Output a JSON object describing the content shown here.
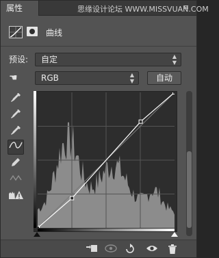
{
  "titlebar": {
    "tab_label": "属性",
    "close_glyph": "✕",
    "menu_glyph": "≡",
    "watermark": "思缘设计论坛 WWW.MISSVUAN.COM"
  },
  "header": {
    "title": "曲线",
    "adjustment_icon": "curves-adjustment-icon",
    "mask_icon": "layer-mask-icon"
  },
  "preset": {
    "label": "预设:",
    "value": "自定"
  },
  "channel": {
    "value": "RGB",
    "auto_label": "自动"
  },
  "tools": [
    {
      "name": "on-image-adjust-icon",
      "glyph": "☚"
    },
    {
      "name": "black-point-eyedropper-icon",
      "glyph": "✎"
    },
    {
      "name": "gray-point-eyedropper-icon",
      "glyph": "✎"
    },
    {
      "name": "white-point-eyedropper-icon",
      "glyph": "✎"
    },
    {
      "name": "curve-points-icon",
      "glyph": "∿"
    },
    {
      "name": "pencil-draw-icon",
      "glyph": "✏"
    },
    {
      "name": "smooth-curve-icon",
      "glyph": "≈"
    },
    {
      "name": "clipping-warning-icon",
      "glyph": "⚠"
    }
  ],
  "curve_points": [
    [
      0,
      0
    ],
    [
      64,
      56
    ],
    [
      192,
      200
    ],
    [
      255,
      255
    ]
  ],
  "bottombar": {
    "icons": [
      "clip-to-layer-icon",
      "view-previous-icon",
      "reset-icon",
      "visibility-eye-icon",
      "delete-trash-icon"
    ]
  },
  "colors": {
    "panel_bg": "#535353",
    "graph_bg": "#2d2d2d",
    "histogram": "#8c8c8c",
    "curve": "#ffffff"
  }
}
